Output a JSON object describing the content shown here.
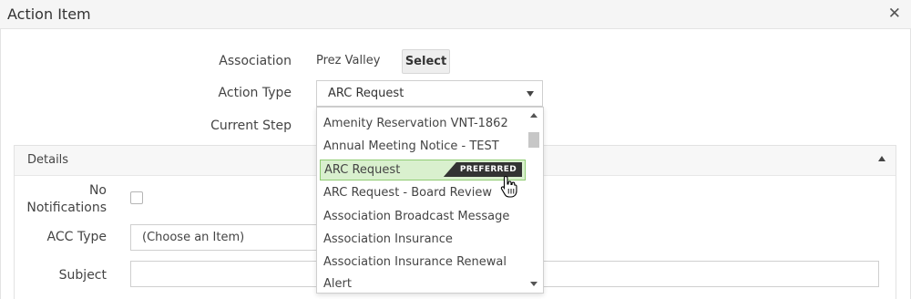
{
  "window": {
    "title": "Action Item"
  },
  "form": {
    "association_label": "Association",
    "association_value": "Prez Valley",
    "select_button": "Select",
    "action_type_label": "Action Type",
    "action_type_value": "ARC Request",
    "current_step_label": "Current Step"
  },
  "details": {
    "title": "Details",
    "no_notifications_label_1": "No",
    "no_notifications_label_2": "Notifications",
    "acc_type_label": "ACC Type",
    "acc_type_value": "(Choose an Item)",
    "subject_label": "Subject",
    "subject_value": ""
  },
  "dropdown": {
    "options": [
      "Amenity Reservation VNT-1862",
      "Annual Meeting Notice - TEST",
      "ARC Request",
      "ARC Request - Board Review",
      "Association Broadcast Message",
      "Association Insurance",
      "Association Insurance Renewal",
      "Alert"
    ],
    "highlighted_tag": "PREFERRED"
  },
  "colors": {
    "highlight_bg": "#d9f0ce",
    "highlight_border": "#8fcc72",
    "tag_bg": "#333333"
  }
}
